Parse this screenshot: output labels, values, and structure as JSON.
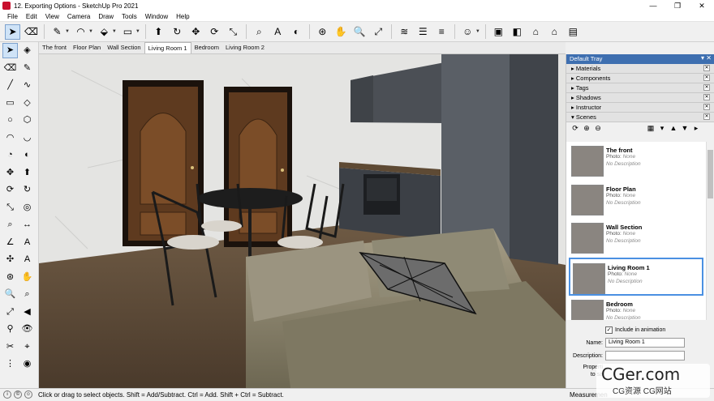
{
  "window": {
    "title": "12. Exporting Options - SketchUp Pro 2021",
    "min": "—",
    "max": "❐",
    "close": "✕"
  },
  "menu": [
    "File",
    "Edit",
    "View",
    "Camera",
    "Draw",
    "Tools",
    "Window",
    "Help"
  ],
  "tabs": [
    "The front",
    "Floor Plan",
    "Wall Section",
    "Living Room 1",
    "Bedroom",
    "Living Room 2"
  ],
  "active_tab": "Living Room 1",
  "tray": {
    "title": "Default Tray",
    "controls": "▾ ✕",
    "panels": [
      {
        "arrow": "▸",
        "label": "Materials"
      },
      {
        "arrow": "▸",
        "label": "Components"
      },
      {
        "arrow": "▸",
        "label": "Tags"
      },
      {
        "arrow": "▸",
        "label": "Shadows"
      },
      {
        "arrow": "▸",
        "label": "Instructor"
      },
      {
        "arrow": "▾",
        "label": "Scenes"
      }
    ],
    "panel_close": "✕",
    "scenes": [
      {
        "name": "The front",
        "photo_label": "Photo:",
        "photo": "None",
        "desc": "No Description"
      },
      {
        "name": "Floor Plan",
        "photo_label": "Photo:",
        "photo": "None",
        "desc": "No Description"
      },
      {
        "name": "Wall Section",
        "photo_label": "Photo:",
        "photo": "None",
        "desc": "No Description"
      },
      {
        "name": "Living Room 1",
        "photo_label": "Photo:",
        "photo": "None",
        "desc": "No Description"
      },
      {
        "name": "Bedroom",
        "photo_label": "Photo:",
        "photo": "None",
        "desc": "No Description"
      }
    ],
    "selected_scene": 3,
    "include_in_animation": "Include in animation",
    "name_label": "Name:",
    "name_value": "Living Room 1",
    "description_label": "Description:",
    "properties_label": "Properti",
    "to_save_label": "to sa"
  },
  "status": {
    "text": "Click or drag to select objects. Shift = Add/Subtract. Ctrl = Add. Shift + Ctrl = Subtract.",
    "measurements": "Measuremen"
  },
  "watermark": {
    "main": "CGer.com",
    "sub": "CG资源 CG网站"
  },
  "icons": {
    "toolbar": [
      [
        "select-icon",
        "➤"
      ],
      [
        "eraser-icon",
        "⌫"
      ],
      [
        "pencil-icon",
        "✎"
      ],
      [
        "arc-icon",
        "◠"
      ],
      [
        "paint-bucket-icon",
        "⬙"
      ],
      [
        "shape-icon",
        "▭"
      ],
      [
        "push-pull-icon",
        "⬆"
      ],
      [
        "follow-me-icon",
        "↻"
      ],
      [
        "move-icon",
        "✥"
      ],
      [
        "rotate-icon",
        "⟳"
      ],
      [
        "scale-icon",
        "⤡"
      ],
      [
        "tape-measure-icon",
        "⌕"
      ],
      [
        "text-icon",
        "A"
      ],
      [
        "paint-icon",
        "◐"
      ],
      [
        "orbit-icon",
        "⊛"
      ],
      [
        "pan-icon",
        "✋"
      ],
      [
        "zoom-icon",
        "🔍"
      ],
      [
        "zoom-extents-icon",
        "⤢"
      ],
      [
        "sandbox-icon",
        "≋"
      ],
      [
        "layers-icon",
        "☰"
      ],
      [
        "flatten-icon",
        "≡"
      ],
      [
        "account-icon",
        "☺"
      ],
      [
        "warehouse-icon",
        "▣"
      ],
      [
        "component-icon",
        "◧"
      ],
      [
        "home-icon",
        "⌂"
      ],
      [
        "house-icon",
        "⌂"
      ],
      [
        "box-icon",
        "▤"
      ]
    ],
    "left": [
      [
        "select-tool-icon",
        "➤"
      ],
      [
        "component-tool-icon",
        "◈"
      ],
      [
        "eraser-tool-icon",
        "⌫"
      ],
      [
        "tag-tool-icon",
        "✎"
      ],
      [
        "line-tool-icon",
        "╱"
      ],
      [
        "freehand-tool-icon",
        "∿"
      ],
      [
        "rectangle-tool-icon",
        "▭"
      ],
      [
        "rotated-rect-tool-icon",
        "◇"
      ],
      [
        "circle-tool-icon",
        "○"
      ],
      [
        "polygon-tool-icon",
        "⬡"
      ],
      [
        "arc-tool-icon",
        "◠"
      ],
      [
        "arc2-tool-icon",
        "◡"
      ],
      [
        "pie-tool-icon",
        "◔"
      ],
      [
        "paint-tool-icon",
        "◐"
      ],
      [
        "move-tool-icon",
        "✥"
      ],
      [
        "push-tool-icon",
        "⬆"
      ],
      [
        "rotate-tool-icon",
        "⟳"
      ],
      [
        "follow-tool-icon",
        "↻"
      ],
      [
        "scale-tool-icon",
        "⤡"
      ],
      [
        "offset-tool-icon",
        "◎"
      ],
      [
        "tape-tool-icon",
        "⌕"
      ],
      [
        "dimension-tool-icon",
        "↔"
      ],
      [
        "protractor-tool-icon",
        "∠"
      ],
      [
        "text-tool-icon",
        "A"
      ],
      [
        "axes-tool-icon",
        "✣"
      ],
      [
        "3dtext-tool-icon",
        "A"
      ],
      [
        "orbit-tool-icon",
        "⊛"
      ],
      [
        "pan-tool-icon",
        "✋"
      ],
      [
        "zoom-tool-icon",
        "🔍"
      ],
      [
        "zoom-window-tool-icon",
        "⌕"
      ],
      [
        "zoom-ext-tool-icon",
        "⤢"
      ],
      [
        "prev-tool-icon",
        "◀"
      ],
      [
        "walk-tool-icon",
        "⚲"
      ],
      [
        "look-tool-icon",
        "👁"
      ],
      [
        "section-tool-icon",
        "✂"
      ],
      [
        "position-tool-icon",
        "⌖"
      ],
      [
        "footprint-tool-icon",
        "⋮"
      ],
      [
        "eye-tool-icon",
        "◉"
      ]
    ],
    "scene_tools": [
      [
        "refresh-icon",
        "⟳"
      ],
      [
        "add-scene-icon",
        "⊕"
      ],
      [
        "remove-scene-icon",
        "⊖"
      ],
      [
        "detail-icon",
        "▦"
      ],
      [
        "view-options-icon",
        "▾"
      ],
      [
        "move-up-icon",
        "▲"
      ],
      [
        "move-down-icon",
        "▼"
      ],
      [
        "more-icon",
        "▸"
      ]
    ]
  }
}
